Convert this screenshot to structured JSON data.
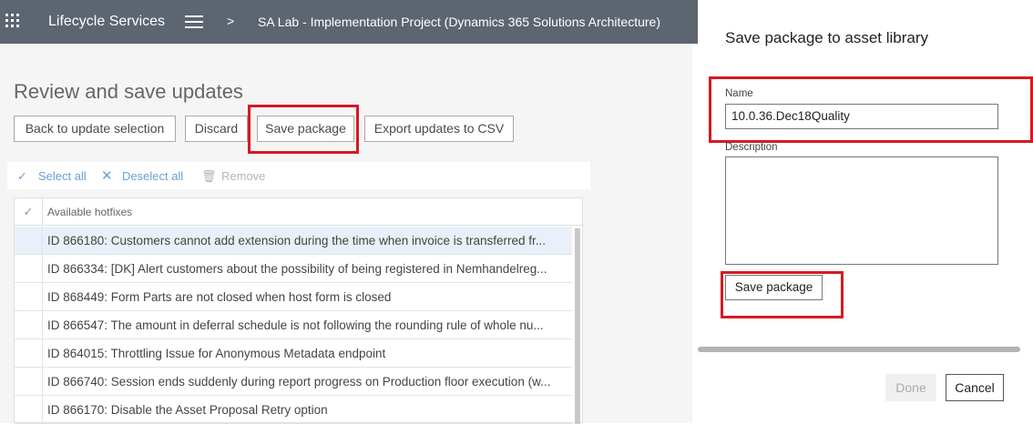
{
  "topbar": {
    "app_title": "Lifecycle Services",
    "breadcrumb_separator": ">",
    "project": "SA Lab - Implementation Project (Dynamics 365 Solutions Architecture)"
  },
  "page": {
    "title": "Review and save updates",
    "toolbar": {
      "back": "Back to update selection",
      "discard": "Discard",
      "save_package": "Save package",
      "export": "Export updates to CSV"
    },
    "actions": {
      "select_all": "Select all",
      "deselect_all": "Deselect all",
      "remove": "Remove"
    },
    "grid": {
      "column": "Available hotfixes",
      "rows": [
        "ID 866180: Customers cannot add extension during the time when invoice is transferred fr...",
        "ID 866334: [DK] Alert customers about the possibility of being registered in Nemhandelreg...",
        "ID 868449: Form Parts are not closed when host form is closed",
        "ID 866547: The amount in deferral schedule is not following the rounding rule of whole nu...",
        "ID 864015: Throttling Issue for Anonymous Metadata endpoint",
        "ID 866740: Session ends suddenly during report progress on Production floor execution (w...",
        "ID 866170: Disable the Asset Proposal Retry option"
      ]
    }
  },
  "dialog": {
    "title": "Save package to asset library",
    "name_label": "Name",
    "name_value": "10.0.36.Dec18Quality",
    "description_label": "Description",
    "description_value": "",
    "save_button": "Save package",
    "done_button": "Done",
    "cancel_button": "Cancel"
  },
  "colors": {
    "topbar": "#5c6570",
    "highlight": "#d41a22",
    "action_blue": "#6b9fd6"
  }
}
